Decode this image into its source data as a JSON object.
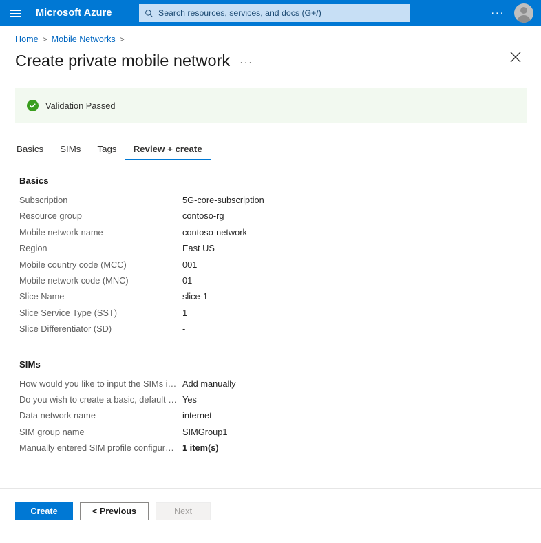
{
  "topbar": {
    "menu_icon": "hamburger-icon",
    "brand": "Microsoft Azure",
    "search": {
      "icon": "search-icon",
      "placeholder": "Search resources, services, and docs (G+/)"
    },
    "more_label": "···",
    "account_icon": "user-avatar-icon",
    "accent_color": "#0078d4"
  },
  "breadcrumb": {
    "items": [
      {
        "label": "Home"
      },
      {
        "label": "Mobile Networks"
      }
    ],
    "separator": ">",
    "link_color": "#0066c0"
  },
  "header": {
    "title": "Create private mobile network",
    "more_label": "···",
    "close_icon": "close-icon"
  },
  "validation": {
    "icon": "success-check-icon",
    "text": "Validation Passed",
    "background": "#f2f9f0",
    "icon_color": "#3a9e1e"
  },
  "tabs": [
    {
      "label": "Basics",
      "active": false
    },
    {
      "label": "SIMs",
      "active": false
    },
    {
      "label": "Tags",
      "active": false
    },
    {
      "label": "Review + create",
      "active": true
    }
  ],
  "sections": [
    {
      "title": "Basics",
      "rows": [
        {
          "label": "Subscription",
          "value": "5G-core-subscription",
          "bold": false
        },
        {
          "label": "Resource group",
          "value": "contoso-rg",
          "bold": false
        },
        {
          "label": "Mobile network name",
          "value": "contoso-network",
          "bold": false
        },
        {
          "label": "Region",
          "value": "East US",
          "bold": false
        },
        {
          "label": "Mobile country code (MCC)",
          "value": "001",
          "bold": false
        },
        {
          "label": "Mobile network code (MNC)",
          "value": "01",
          "bold": false
        },
        {
          "label": "Slice Name",
          "value": "slice-1",
          "bold": false
        },
        {
          "label": "Slice Service Type (SST)",
          "value": "1",
          "bold": false
        },
        {
          "label": "Slice Differentiator (SD)",
          "value": "-",
          "bold": false
        }
      ]
    },
    {
      "title": "SIMs",
      "rows": [
        {
          "label": "How would you like to input the SIMs information?",
          "value": "Add manually",
          "bold": false
        },
        {
          "label": "Do you wish to create a basic, default policy?",
          "value": "Yes",
          "bold": false
        },
        {
          "label": "Data network name",
          "value": "internet",
          "bold": false
        },
        {
          "label": "SIM group name",
          "value": "SIMGroup1",
          "bold": false
        },
        {
          "label": "Manually entered SIM profile configuration",
          "value": "1 item(s)",
          "bold": true
        }
      ]
    }
  ],
  "footer": {
    "create_label": "Create",
    "previous_label": "< Previous",
    "next_label": "Next"
  }
}
